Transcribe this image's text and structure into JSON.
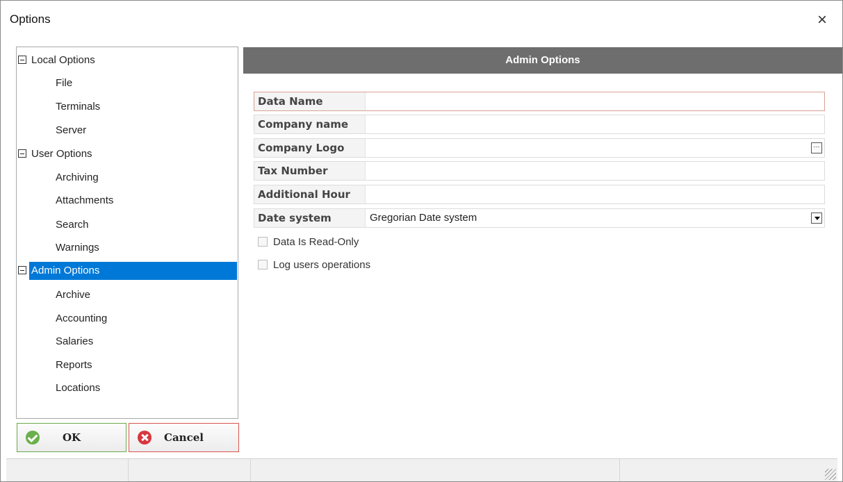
{
  "window": {
    "title": "Options",
    "close_glyph": "×"
  },
  "tree": {
    "groups": [
      {
        "label": "Local Options",
        "items": [
          "File",
          "Terminals",
          "Server"
        ]
      },
      {
        "label": "User Options",
        "items": [
          "Archiving",
          "Attachments",
          "Search",
          "Warnings"
        ]
      },
      {
        "label": "Admin Options",
        "selected": true,
        "items": [
          "Archive",
          "Accounting",
          "Salaries",
          "Reports",
          "Locations"
        ]
      }
    ]
  },
  "buttons": {
    "ok": "OK",
    "cancel": "Cancel"
  },
  "panel": {
    "title": "Admin Options",
    "fields": [
      {
        "label": "Data Name",
        "value": ""
      },
      {
        "label": "Company name",
        "value": ""
      },
      {
        "label": "Company Logo",
        "value": "",
        "button": "···"
      },
      {
        "label": "Tax Number",
        "value": ""
      },
      {
        "label": "Additional Hour",
        "value": ""
      },
      {
        "label": "Date system",
        "value": "Gregorian Date system"
      }
    ],
    "checkboxes": [
      {
        "label": "Data Is Read-Only",
        "checked": false
      },
      {
        "label": "Log users operations",
        "checked": false
      }
    ]
  },
  "colors": {
    "selection": "#0078d7",
    "header": "#6e6e6e",
    "ok_icon": "#6ab04c",
    "cancel_icon": "#d9363e"
  }
}
